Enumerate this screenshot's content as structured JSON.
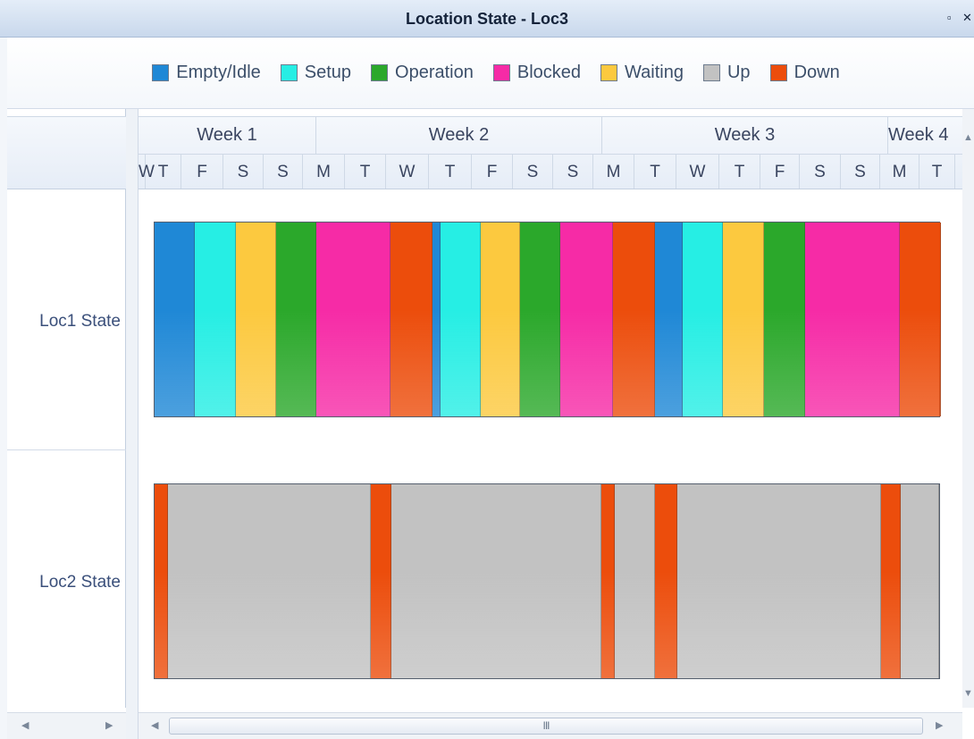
{
  "window": {
    "title": "Location State - Loc3",
    "restore_glyph": "▫",
    "close_glyph": "✕"
  },
  "legend": [
    {
      "label": "Empty/Idle",
      "color": "#1f88d6"
    },
    {
      "label": "Setup",
      "color": "#26eee4"
    },
    {
      "label": "Operation",
      "color": "#2ba82b"
    },
    {
      "label": "Blocked",
      "color": "#f62ba6"
    },
    {
      "label": "Waiting",
      "color": "#fcc93f"
    },
    {
      "label": "Up",
      "color": "#c2c2c2"
    },
    {
      "label": "Down",
      "color": "#ec4d0c"
    }
  ],
  "weeks": [
    "Week 1",
    "Week 2",
    "Week 3",
    "Week 4"
  ],
  "days": [
    "W",
    "T",
    "F",
    "S",
    "S",
    "M",
    "T",
    "W",
    "T",
    "F",
    "S",
    "S",
    "M",
    "T",
    "W",
    "T",
    "F",
    "S",
    "S",
    "M",
    "T"
  ],
  "rows": [
    {
      "label": "Loc1 State",
      "states": [
        "Empty/Idle",
        "Setup",
        "Waiting",
        "Operation",
        "Blocked",
        "Down",
        "Empty/Idle",
        "Setup",
        "Waiting",
        "Operation",
        "Blocked",
        "Down",
        "Empty/Idle",
        "Setup",
        "Waiting",
        "Operation",
        "Blocked",
        "Down"
      ]
    },
    {
      "label": "Loc2 State",
      "states": [
        "Down",
        "Up",
        "Down",
        "Up",
        "Down",
        "Up",
        "Down",
        "Up",
        "Down",
        "Up"
      ]
    }
  ],
  "scroll": {
    "up_arrow": "▲",
    "down_arrow": "▼",
    "left_arrow": "◀",
    "right_arrow": "▶",
    "grip": "III"
  }
}
